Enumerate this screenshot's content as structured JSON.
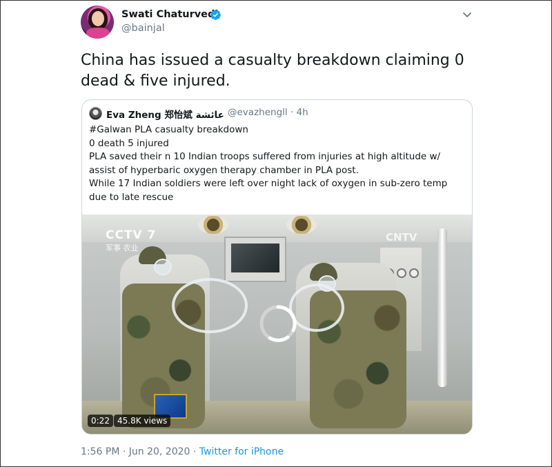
{
  "author": {
    "name": "Swati Chaturvedi",
    "handle": "@bainjal",
    "verified": true,
    "avatar_icon": "profile-avatar"
  },
  "tweet": {
    "text": "China has issued a casualty breakdown claiming 0 dead & five injured."
  },
  "quoted": {
    "name": "Eva Zheng 郑怡斌 عائشة",
    "handle": "@evazhengll",
    "separator": "·",
    "age": "4h",
    "lines": [
      "#Galwan PLA casualty breakdown",
      "0 death 5 injured",
      "PLA saved their n 10 Indian troops suffered from injuries at high altitude w/",
      "assist of hyperbaric oxygen therapy chamber in PLA post.",
      "While 17 Indian soldiers were left over night lack of oxygen in sub-zero temp",
      "due to late rescue"
    ]
  },
  "video": {
    "duration": "0:22",
    "views": "45.8K views",
    "overlay_top_left": "CCTV 7",
    "overlay_sub": "军事 农业",
    "overlay_top_right": "CNTV",
    "state_icon": "loading-spinner-icon"
  },
  "footer": {
    "timestamp": "1:56 PM · Jun 20, 2020 · ",
    "source": "Twitter for iPhone"
  },
  "colors": {
    "link": "#1b95e0",
    "secondary_text": "#657786",
    "verified": "#1da1f2",
    "border": "#ccd6dd"
  }
}
